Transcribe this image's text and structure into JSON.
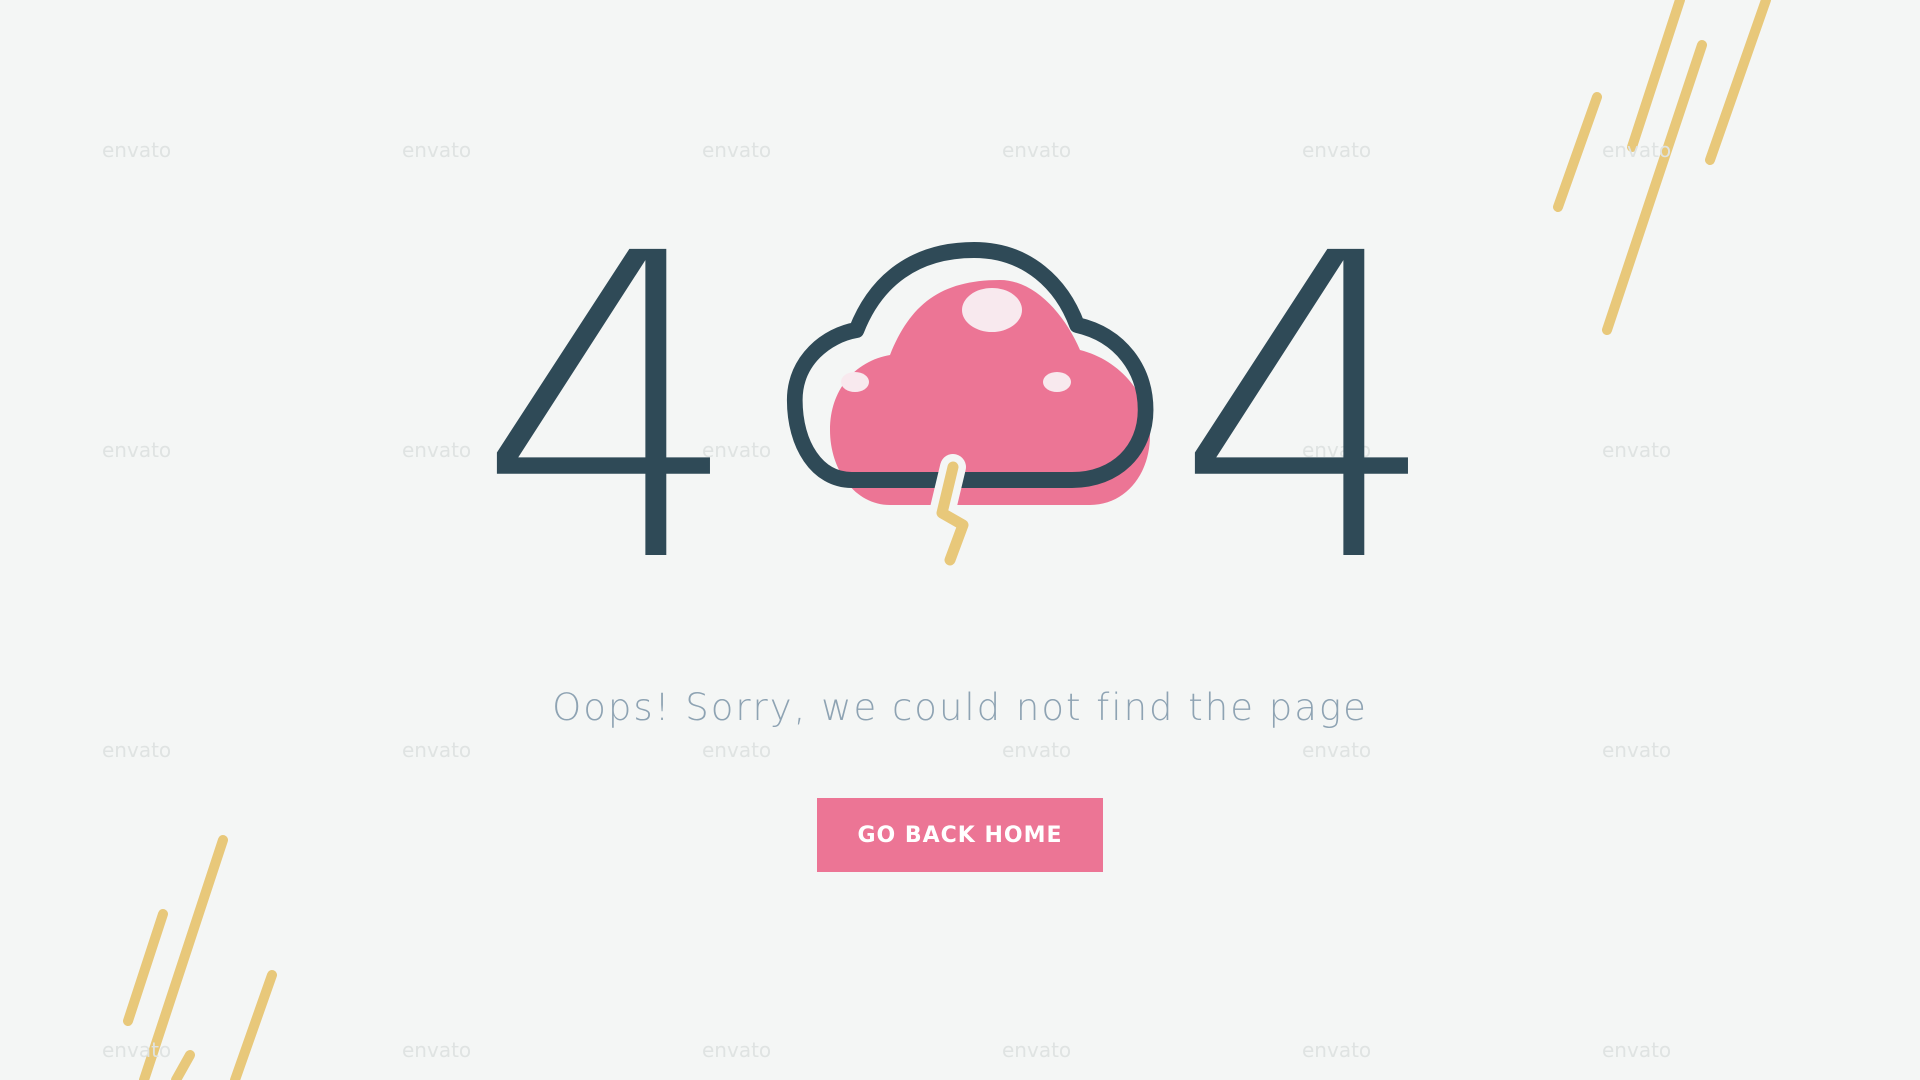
{
  "error": {
    "digit_left": "4",
    "digit_right": "4",
    "message": "Oops! Sorry, we could not find the page"
  },
  "actions": {
    "home_button_label": "GO BACK HOME"
  },
  "watermark": {
    "text": "envato"
  },
  "icons": {
    "center": "storm-cloud-icon"
  },
  "colors": {
    "background": "#f4f6f5",
    "digits": "#2f4a57",
    "cloud_fill": "#ec7595",
    "lightning": "#e8c87a",
    "message": "#8ea3b3",
    "button": "#ec7595",
    "button_text": "#ffffff"
  }
}
